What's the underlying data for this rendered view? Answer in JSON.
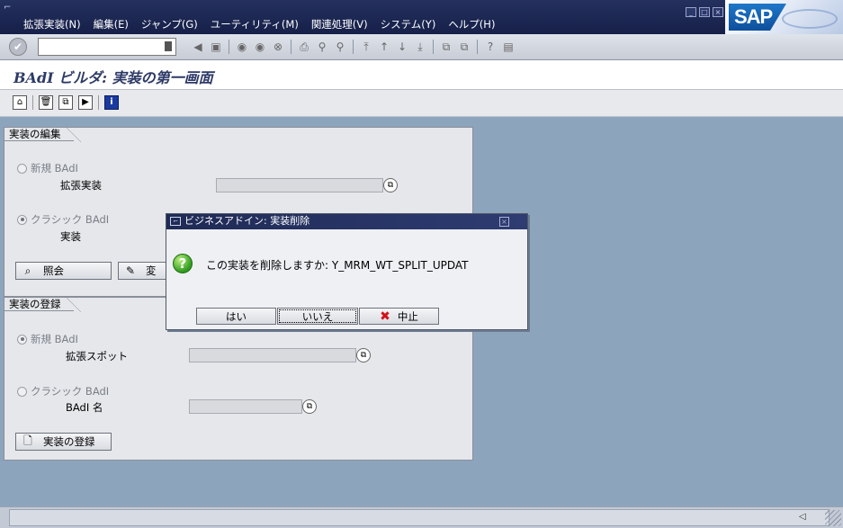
{
  "menubar": {
    "items": [
      "拡張実装(N)",
      "編集(E)",
      "ジャンプ(G)",
      "ユーティリティ(M)",
      "関連処理(V)",
      "システム(Y)",
      "ヘルプ(H)"
    ],
    "logo": "SAP"
  },
  "title": "BAdI ビルダ: 実装の第一画面",
  "edit_group": {
    "title": "実装の編集",
    "radio_new": {
      "label": "新規 BAdI",
      "selected": false
    },
    "field_impl_new_label": "拡張実装",
    "radio_classic": {
      "label": "クラシック BAdI",
      "selected": true
    },
    "field_impl_label": "実装",
    "display_button": "照会",
    "change_button": "変"
  },
  "create_group": {
    "title": "実装の登録",
    "radio_new": {
      "label": "新規 BAdI",
      "selected": true
    },
    "field_spot_label": "拡張スポット",
    "radio_classic": {
      "label": "クラシック BAdI",
      "selected": false
    },
    "field_badi_label": "BAdI 名",
    "create_button": "実装の登録"
  },
  "dialog": {
    "title": "ビジネスアドイン: 実装削除",
    "question": "この実装を削除しますか: Y_MRM_WT_SPLIT_UPDAT",
    "yes": "はい",
    "no": "いいえ",
    "cancel": "中止"
  },
  "colors": {
    "menubar": "#1b2652",
    "main_bg": "#8da4bd",
    "title_text": "#2d3a66",
    "cancel_x": "#d3121b",
    "question_icon": "#2e9a1e"
  }
}
